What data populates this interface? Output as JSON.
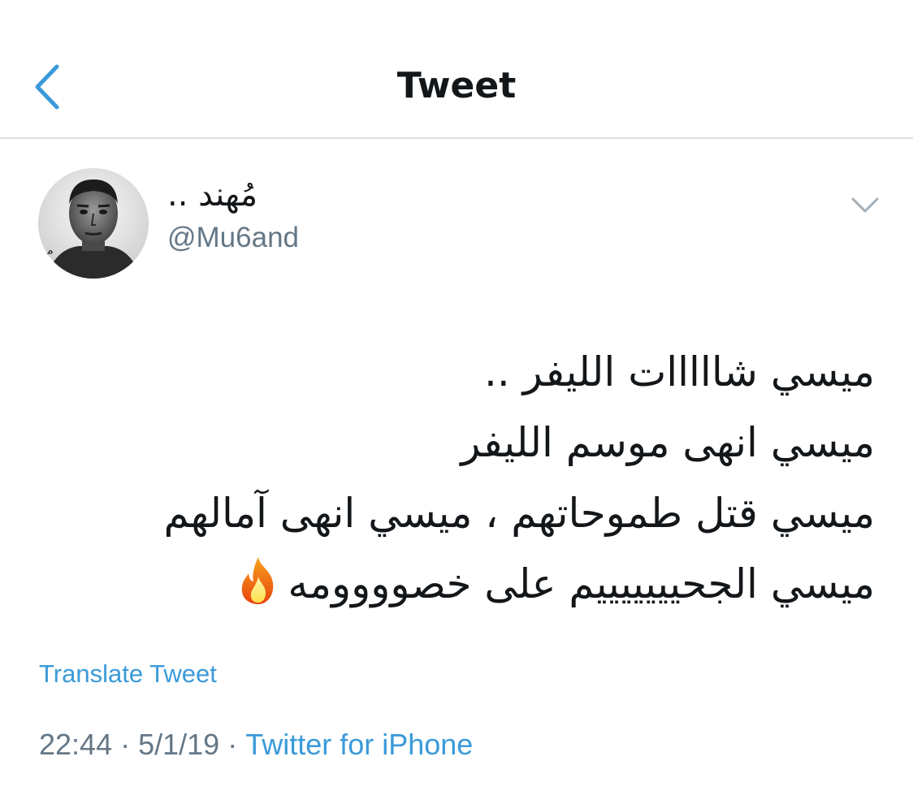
{
  "header": {
    "title": "Tweet",
    "back_icon": "chevron-left-icon"
  },
  "tweet": {
    "author": {
      "display_name": "مُهند ..",
      "handle": "@Mu6and",
      "avatar_icon": "avatar-photo"
    },
    "menu_icon": "chevron-down-icon",
    "lines": [
      "ميسي شااااات الليفر ..",
      "ميسي انهى موسم الليفر",
      "ميسي قتل طموحاتهم ، ميسي انهى آمالهم",
      "ميسي الجحيييييييم على خصوووومه"
    ],
    "trailing_emoji": "fire-icon",
    "translate_label": "Translate Tweet",
    "time": "22:44",
    "date": "5/1/19",
    "separator": "·",
    "source": "Twitter for iPhone"
  },
  "colors": {
    "accent": "#3a9ad9",
    "secondary_text": "#657786",
    "primary_text": "#14171a",
    "divider": "#dcdfe3"
  }
}
